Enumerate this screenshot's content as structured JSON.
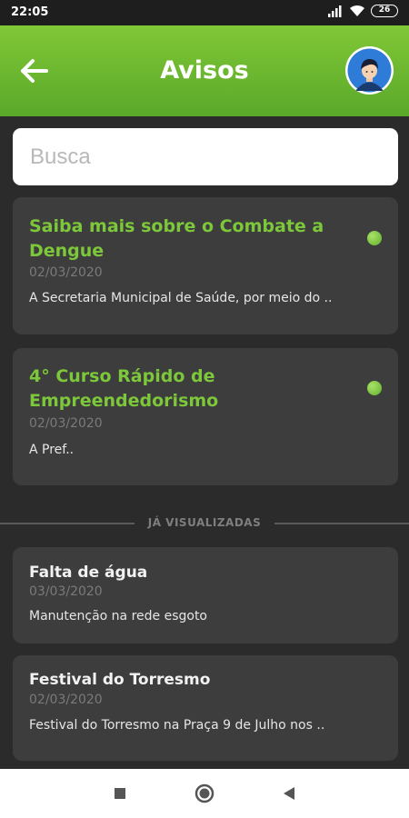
{
  "status_bar": {
    "time": "22:05",
    "battery": "26",
    "icons": [
      "signal-icon",
      "wifi-icon",
      "battery-icon"
    ]
  },
  "app_bar": {
    "title": "Avisos",
    "back_icon": "arrow-left-icon",
    "avatar_icon": "user-avatar"
  },
  "search": {
    "placeholder": "Busca",
    "value": ""
  },
  "unread": [
    {
      "title": "Saiba mais sobre o Combate a Dengue",
      "date": "02/03/2020",
      "excerpt": "A Secretaria Municipal de Saúde, por meio do .."
    },
    {
      "title": "4° Curso Rápido de Empreendedorismo",
      "date": "02/03/2020",
      "excerpt": "A Pref.."
    }
  ],
  "divider_label": "JÁ VISUALIZADAS",
  "read": [
    {
      "title": "Falta de água",
      "date": "03/03/2020",
      "excerpt": "Manutenção na rede esgoto"
    },
    {
      "title": "Festival do Torresmo",
      "date": "02/03/2020",
      "excerpt": "Festival do Torresmo na Praça 9 de Julho nos .."
    }
  ],
  "colors": {
    "accent": "#7cc83a",
    "header_top": "#8bd13a",
    "header_bottom": "#5aa82a",
    "background": "#2b2b2b",
    "card": "#3d3d3d"
  },
  "nav": [
    "recent-apps-icon",
    "home-icon",
    "back-triangle-icon"
  ]
}
